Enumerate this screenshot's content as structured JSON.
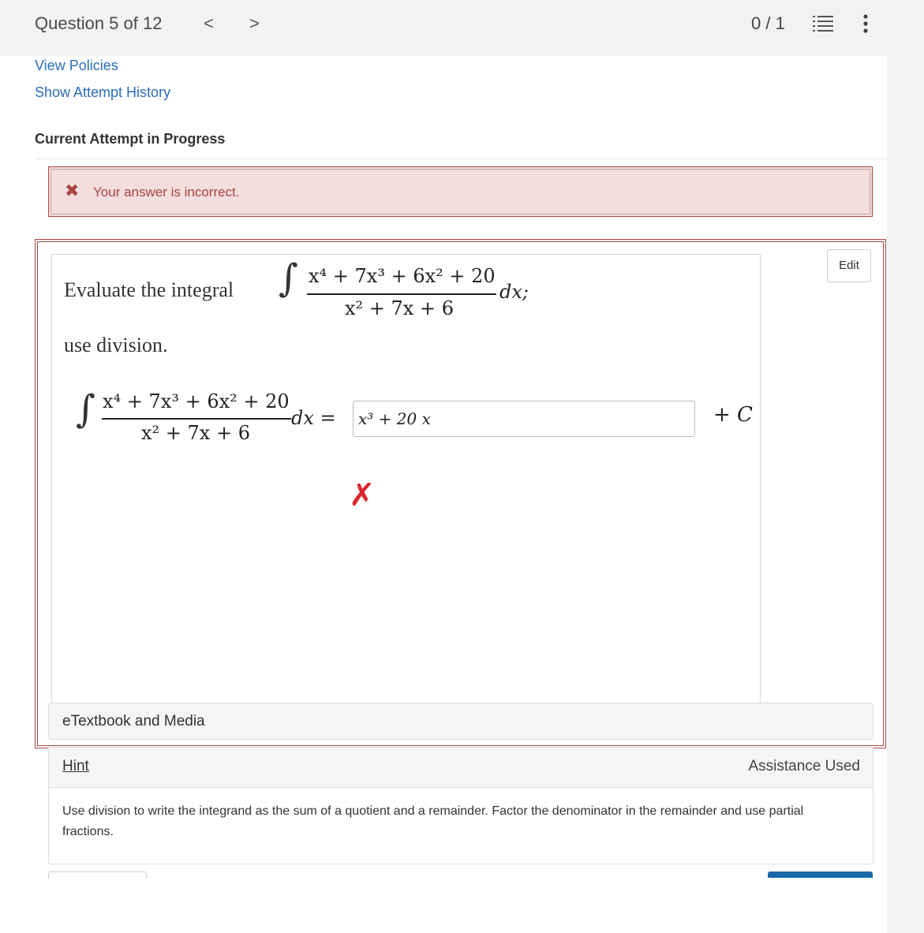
{
  "header": {
    "question_label": "Question 5 of 12",
    "prev_glyph": "<",
    "next_glyph": ">",
    "score": "0 / 1"
  },
  "links": {
    "view_policies": "View Policies",
    "attempt_history": "Show Attempt History"
  },
  "attempt_status": "Current Attempt in Progress",
  "alert": {
    "icon": "✖",
    "message": "Your answer is incorrect."
  },
  "question": {
    "edit_label": "Edit",
    "prompt_prefix": "Evaluate the integral",
    "prompt_suffix": "use division.",
    "numerator": "x⁴ + 7x³ + 6x² + 20",
    "denominator": "x² + 7x + 6",
    "dx_semicolon": "dx;",
    "dx_equals": "dx =",
    "answer_value": "x³ + 20 x",
    "constant": "+ C",
    "result_mark": "✗"
  },
  "etextbook_label": "eTextbook and Media",
  "hint": {
    "label": "Hint",
    "status": "Assistance Used",
    "text": "Use division to write the integrand as the sum of a quotient and a remainder. Factor the denominator in the remainder and use partial fractions."
  },
  "colors": {
    "link": "#2a6ebb",
    "error": "#a94442",
    "error_bg": "#f2dede",
    "wrong_mark": "#d9262c",
    "primary_button": "#1b6aaa"
  }
}
